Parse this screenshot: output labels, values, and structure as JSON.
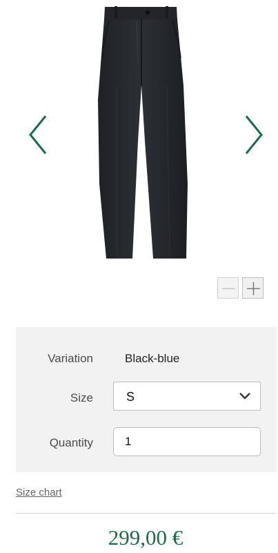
{
  "gallery": {
    "product_image_alt": "",
    "prev_icon": "chevron-left-icon",
    "next_icon": "chevron-right-icon",
    "zoom_out_icon": "minus-icon",
    "zoom_in_icon": "plus-icon",
    "accent_color": "#1e6b47"
  },
  "options": {
    "variation_label": "Variation",
    "variation_value": "Black-blue",
    "size_label": "Size",
    "size_value": "S",
    "size_icon": "chevron-down-icon",
    "quantity_label": "Quantity",
    "quantity_value": "1"
  },
  "size_chart_label": "Size chart",
  "price": "299,00 €",
  "colors": {
    "accent": "#1e6b47",
    "panel_bg": "#f2f2f2"
  }
}
